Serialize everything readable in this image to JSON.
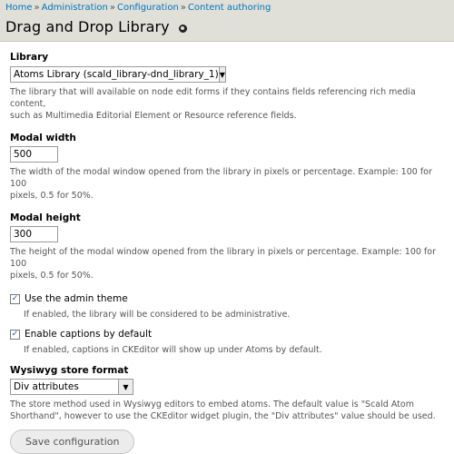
{
  "breadcrumb": {
    "items": [
      "Home",
      "Administration",
      "Configuration",
      "Content authoring"
    ],
    "separator": "»"
  },
  "page_title": "Drag and Drop Library",
  "fields": {
    "library": {
      "label": "Library",
      "value": "Atoms Library (scald_library-dnd_library_1)",
      "description_line1": "The library that will available on node edit forms if they contains fields referencing rich media content,",
      "description_line2": "such as Multimedia Editorial Element or Resource reference fields."
    },
    "modal_width": {
      "label": "Modal width",
      "value": "500",
      "description_line1": "The width of the modal window opened from the library in pixels or percentage. Example: 100 for 100",
      "description_line2": "pixels, 0.5 for 50%."
    },
    "modal_height": {
      "label": "Modal height",
      "value": "300",
      "description_line1": "The height of the modal window opened from the library in pixels or percentage. Example: 100 for 100",
      "description_line2": "pixels, 0.5 for 50%."
    },
    "admin_theme": {
      "label": "Use the admin theme",
      "checked": true,
      "description": "If enabled, the library will be considered to be administrative."
    },
    "captions": {
      "label": "Enable captions by default",
      "checked": true,
      "description": "If enabled, captions in CKEditor will show up under Atoms by default."
    },
    "wysiwyg_format": {
      "label": "Wysiwyg store format",
      "value": "Div attributes",
      "description_line1": "The store method used in Wysiwyg editors to embed atoms. The default value is \"Scald Atom",
      "description_line2": "Shorthand\", however to use the CKEditor widget plugin, the \"Div attributes\" value should be used."
    }
  },
  "submit_label": "Save configuration",
  "icons": {
    "shortcut": "shortcut-star-icon",
    "dropdown": "chevron-down-icon",
    "check": "checkmark-icon"
  },
  "colors": {
    "header_bg": "#e0e0d8",
    "link": "#0074bd"
  }
}
